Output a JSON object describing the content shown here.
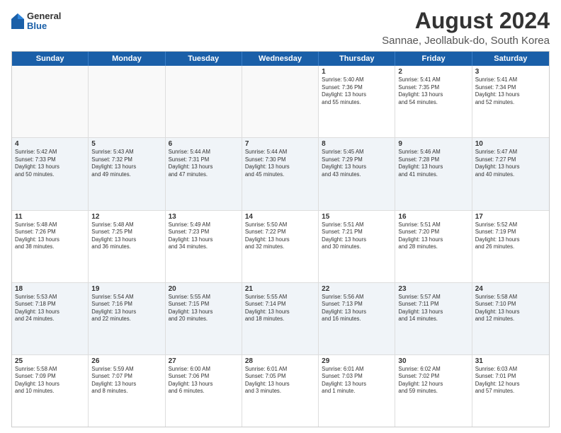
{
  "logo": {
    "general": "General",
    "blue": "Blue"
  },
  "title": "August 2024",
  "subtitle": "Sannae, Jeollabuk-do, South Korea",
  "days": [
    "Sunday",
    "Monday",
    "Tuesday",
    "Wednesday",
    "Thursday",
    "Friday",
    "Saturday"
  ],
  "rows": [
    [
      {
        "day": "",
        "info": ""
      },
      {
        "day": "",
        "info": ""
      },
      {
        "day": "",
        "info": ""
      },
      {
        "day": "",
        "info": ""
      },
      {
        "day": "1",
        "info": "Sunrise: 5:40 AM\nSunset: 7:36 PM\nDaylight: 13 hours\nand 55 minutes."
      },
      {
        "day": "2",
        "info": "Sunrise: 5:41 AM\nSunset: 7:35 PM\nDaylight: 13 hours\nand 54 minutes."
      },
      {
        "day": "3",
        "info": "Sunrise: 5:41 AM\nSunset: 7:34 PM\nDaylight: 13 hours\nand 52 minutes."
      }
    ],
    [
      {
        "day": "4",
        "info": "Sunrise: 5:42 AM\nSunset: 7:33 PM\nDaylight: 13 hours\nand 50 minutes."
      },
      {
        "day": "5",
        "info": "Sunrise: 5:43 AM\nSunset: 7:32 PM\nDaylight: 13 hours\nand 49 minutes."
      },
      {
        "day": "6",
        "info": "Sunrise: 5:44 AM\nSunset: 7:31 PM\nDaylight: 13 hours\nand 47 minutes."
      },
      {
        "day": "7",
        "info": "Sunrise: 5:44 AM\nSunset: 7:30 PM\nDaylight: 13 hours\nand 45 minutes."
      },
      {
        "day": "8",
        "info": "Sunrise: 5:45 AM\nSunset: 7:29 PM\nDaylight: 13 hours\nand 43 minutes."
      },
      {
        "day": "9",
        "info": "Sunrise: 5:46 AM\nSunset: 7:28 PM\nDaylight: 13 hours\nand 41 minutes."
      },
      {
        "day": "10",
        "info": "Sunrise: 5:47 AM\nSunset: 7:27 PM\nDaylight: 13 hours\nand 40 minutes."
      }
    ],
    [
      {
        "day": "11",
        "info": "Sunrise: 5:48 AM\nSunset: 7:26 PM\nDaylight: 13 hours\nand 38 minutes."
      },
      {
        "day": "12",
        "info": "Sunrise: 5:48 AM\nSunset: 7:25 PM\nDaylight: 13 hours\nand 36 minutes."
      },
      {
        "day": "13",
        "info": "Sunrise: 5:49 AM\nSunset: 7:23 PM\nDaylight: 13 hours\nand 34 minutes."
      },
      {
        "day": "14",
        "info": "Sunrise: 5:50 AM\nSunset: 7:22 PM\nDaylight: 13 hours\nand 32 minutes."
      },
      {
        "day": "15",
        "info": "Sunrise: 5:51 AM\nSunset: 7:21 PM\nDaylight: 13 hours\nand 30 minutes."
      },
      {
        "day": "16",
        "info": "Sunrise: 5:51 AM\nSunset: 7:20 PM\nDaylight: 13 hours\nand 28 minutes."
      },
      {
        "day": "17",
        "info": "Sunrise: 5:52 AM\nSunset: 7:19 PM\nDaylight: 13 hours\nand 26 minutes."
      }
    ],
    [
      {
        "day": "18",
        "info": "Sunrise: 5:53 AM\nSunset: 7:18 PM\nDaylight: 13 hours\nand 24 minutes."
      },
      {
        "day": "19",
        "info": "Sunrise: 5:54 AM\nSunset: 7:16 PM\nDaylight: 13 hours\nand 22 minutes."
      },
      {
        "day": "20",
        "info": "Sunrise: 5:55 AM\nSunset: 7:15 PM\nDaylight: 13 hours\nand 20 minutes."
      },
      {
        "day": "21",
        "info": "Sunrise: 5:55 AM\nSunset: 7:14 PM\nDaylight: 13 hours\nand 18 minutes."
      },
      {
        "day": "22",
        "info": "Sunrise: 5:56 AM\nSunset: 7:13 PM\nDaylight: 13 hours\nand 16 minutes."
      },
      {
        "day": "23",
        "info": "Sunrise: 5:57 AM\nSunset: 7:11 PM\nDaylight: 13 hours\nand 14 minutes."
      },
      {
        "day": "24",
        "info": "Sunrise: 5:58 AM\nSunset: 7:10 PM\nDaylight: 13 hours\nand 12 minutes."
      }
    ],
    [
      {
        "day": "25",
        "info": "Sunrise: 5:58 AM\nSunset: 7:09 PM\nDaylight: 13 hours\nand 10 minutes."
      },
      {
        "day": "26",
        "info": "Sunrise: 5:59 AM\nSunset: 7:07 PM\nDaylight: 13 hours\nand 8 minutes."
      },
      {
        "day": "27",
        "info": "Sunrise: 6:00 AM\nSunset: 7:06 PM\nDaylight: 13 hours\nand 6 minutes."
      },
      {
        "day": "28",
        "info": "Sunrise: 6:01 AM\nSunset: 7:05 PM\nDaylight: 13 hours\nand 3 minutes."
      },
      {
        "day": "29",
        "info": "Sunrise: 6:01 AM\nSunset: 7:03 PM\nDaylight: 13 hours\nand 1 minute."
      },
      {
        "day": "30",
        "info": "Sunrise: 6:02 AM\nSunset: 7:02 PM\nDaylight: 12 hours\nand 59 minutes."
      },
      {
        "day": "31",
        "info": "Sunrise: 6:03 AM\nSunset: 7:01 PM\nDaylight: 12 hours\nand 57 minutes."
      }
    ]
  ]
}
